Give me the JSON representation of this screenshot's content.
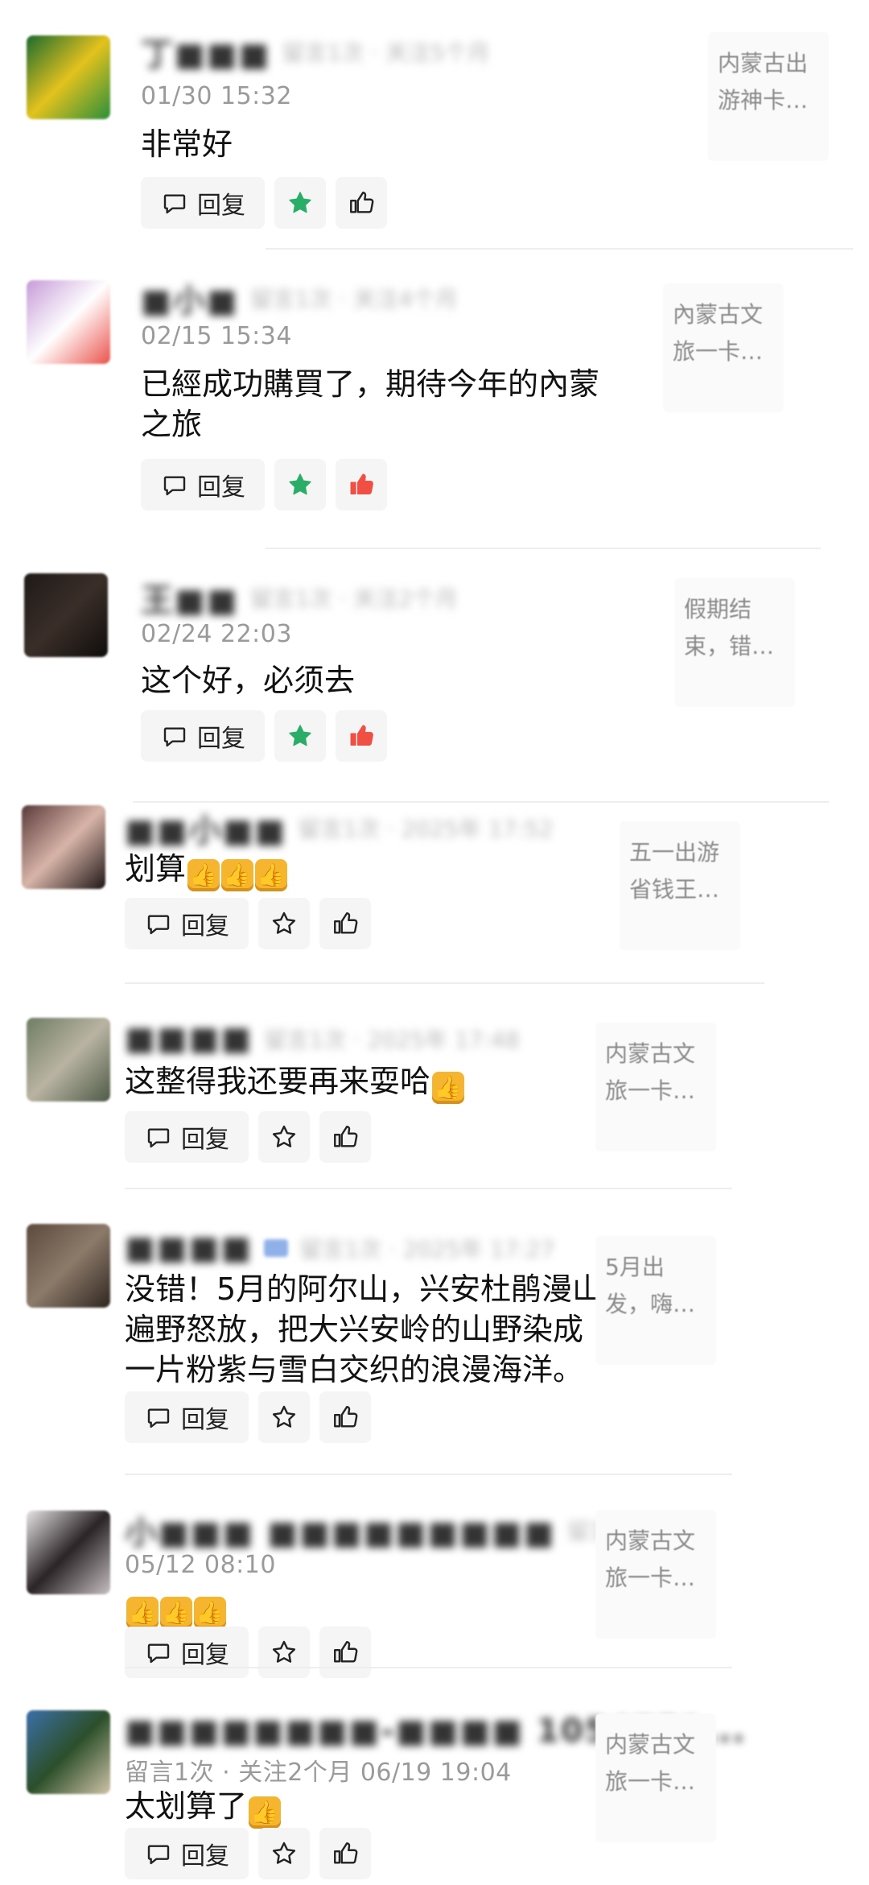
{
  "comments": [
    {
      "name": "丁■■■",
      "meta": "留言1次 · 关注5个月",
      "time": "01/30 15:32",
      "lines": [
        "非常好"
      ],
      "reply_label": "回复",
      "starred": true,
      "liked": false,
      "article": [
        "内蒙古出",
        "游神卡…"
      ],
      "avatar": [
        "#1b6b2e",
        "#e3c21d",
        "#2a8f3a"
      ]
    },
    {
      "name": "■小■",
      "meta": "留言1次 · 关注4个月",
      "time": "02/15 15:34",
      "lines": [
        "已經成功購買了，期待今年的內蒙",
        "之旅"
      ],
      "reply_label": "回复",
      "starred": true,
      "liked": true,
      "article": [
        "內蒙古文",
        "旅一卡…"
      ],
      "avatar": [
        "#c79bd8",
        "#ffffff",
        "#e9534c"
      ]
    },
    {
      "name": "王■■",
      "meta": "留言1次 · 关注2个月",
      "time": "02/24 22:03",
      "lines": [
        "这个好，必须去"
      ],
      "reply_label": "回复",
      "starred": true,
      "liked": true,
      "article": [
        "假期结",
        "束，错…"
      ],
      "avatar": [
        "#1e1a18",
        "#3a2e28",
        "#0f0d0c"
      ]
    },
    {
      "name": "■■小■■",
      "meta": "留言1次 · 2025年 17:52",
      "time": "",
      "lines": [
        "划算"
      ],
      "emoji_count": 3,
      "reply_label": "回复",
      "starred": false,
      "liked": false,
      "article": [
        "五一出游",
        "省钱王…"
      ],
      "avatar": [
        "#5a3a3a",
        "#d8b4a8",
        "#1e1616"
      ]
    },
    {
      "name": "■■■■",
      "meta": "留言1次 · 2025年 17:48",
      "time": "",
      "lines": [
        "这整得我还要再来耍哈"
      ],
      "emoji_count": 1,
      "reply_label": "回复",
      "starred": false,
      "liked": false,
      "article": [
        "内蒙古文",
        "旅一卡…"
      ],
      "avatar": [
        "#6f7d64",
        "#b9b3a2",
        "#4d5a46"
      ]
    },
    {
      "name": "■■■■",
      "meta": "留言1次 · 2025年 17:27",
      "time": "",
      "lines": [
        "没错！5月的阿尔山，兴安杜鹃漫山",
        "遍野怒放，把大兴安岭的山野染成",
        "一片粉紫与雪白交织的浪漫海洋。"
      ],
      "reply_label": "回复",
      "starred": false,
      "liked": false,
      "article": [
        "5月出",
        "发，嗨…"
      ],
      "avatar": [
        "#5c4a3e",
        "#8c7a6a",
        "#2f2620"
      ]
    },
    {
      "name": "小■■■ ■■■■■■■■■",
      "meta": "留言1次",
      "time": "05/12 08:10",
      "lines": [
        ""
      ],
      "emoji_count": 3,
      "reply_label": "回复",
      "starred": false,
      "liked": false,
      "article": [
        "内蒙古文",
        "旅一卡…"
      ],
      "avatar": [
        "#e8e4e6",
        "#2a2426",
        "#c7bfc2"
      ]
    },
    {
      "name": "■■■■■■■■-■■■■ 1054751...",
      "meta": "",
      "time": "留言1次 · 关注2个月   06/19 19:04",
      "lines": [
        "太划算了"
      ],
      "emoji_count": 1,
      "reply_label": "回复",
      "starred": false,
      "liked": false,
      "article": [
        "内蒙古文",
        "旅一卡…"
      ],
      "avatar": [
        "#3b6fa8",
        "#2c4f2a",
        "#cfc2a8"
      ]
    }
  ],
  "colors": {
    "star_active": "#2aae67",
    "like_active": "#f04f43",
    "icon_inactive": "#222222"
  }
}
